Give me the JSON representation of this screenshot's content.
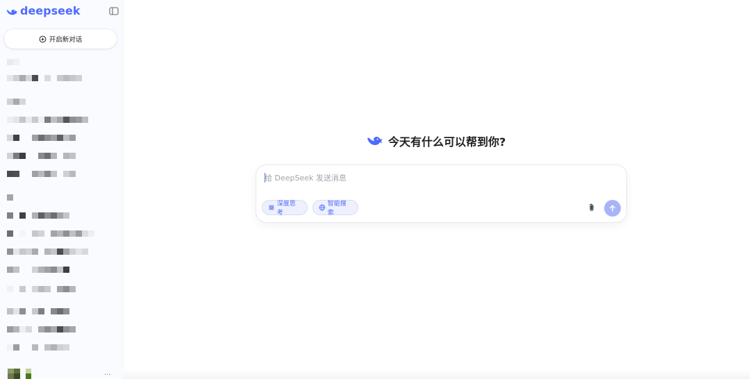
{
  "sidebar": {
    "logo_text": "deepseek",
    "logo_icon": "deepseek-whale-icon",
    "toggle_icon": "sidebar-toggle-icon",
    "new_chat_label": "开启新对话",
    "new_chat_icon": "plus-circle-icon",
    "more_icon_label": "...",
    "avatar_icon": "user-avatar"
  },
  "main": {
    "welcome_text": "今天有什么可以帮到你?",
    "input_placeholder": "给 DeepSeek 发送消息",
    "deep_think_label": "深度思考",
    "deep_think_icon": "atom-icon",
    "web_search_label": "智能搜索",
    "web_search_icon": "globe-icon",
    "attach_icon": "paperclip-icon",
    "send_icon": "arrow-up-icon"
  },
  "colors": {
    "brand": "#4d6bfe",
    "sidebar_bg": "#f9fbff",
    "send_disabled": "#a8b4f8",
    "pill_bg": "#eef1fd"
  }
}
